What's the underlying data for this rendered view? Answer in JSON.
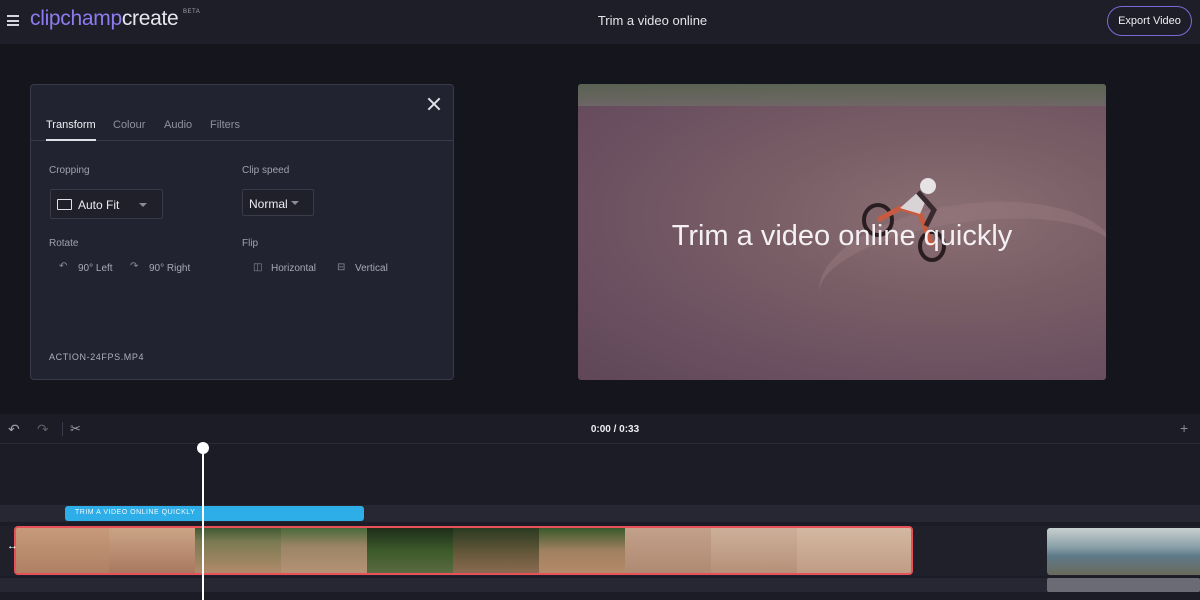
{
  "app": {
    "logo_part1": "clipchamp",
    "logo_part2": "create",
    "beta": "BETA",
    "page_title": "Trim a video online",
    "export_label": "Export Video"
  },
  "panel": {
    "tabs": [
      "Transform",
      "Colour",
      "Audio",
      "Filters"
    ],
    "active_tab": "Transform",
    "cropping_label": "Cropping",
    "cropping_value": "Auto Fit",
    "clip_speed_label": "Clip speed",
    "clip_speed_value": "Normal",
    "rotate_label": "Rotate",
    "rotate_left": "90° Left",
    "rotate_right": "90° Right",
    "flip_label": "Flip",
    "flip_horizontal": "Horizontal",
    "flip_vertical": "Vertical",
    "filename": "ACTION-24FPS.MP4"
  },
  "preview": {
    "overlay_text": "Trim a video online quickly"
  },
  "timeline": {
    "timecode": "0:00 / 0:33",
    "text_clip_label": "TRIM A VIDEO ONLINE QUICKLY",
    "icons": [
      "undo-icon",
      "redo-icon",
      "scissors-icon",
      "add-icon"
    ]
  },
  "colors": {
    "accent": "#7a6ad8",
    "text_clip": "#2eaee8",
    "selected_clip_border": "#e8505a"
  }
}
